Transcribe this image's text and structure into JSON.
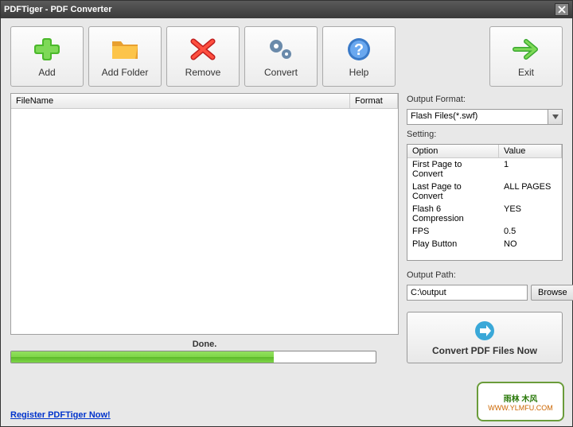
{
  "window": {
    "title": "PDFTiger - PDF Converter"
  },
  "toolbar": {
    "add": "Add",
    "add_folder": "Add Folder",
    "remove": "Remove",
    "convert": "Convert",
    "help": "Help",
    "exit": "Exit"
  },
  "file_table": {
    "col_name": "FileName",
    "col_format": "Format"
  },
  "output": {
    "format_label": "Output Format:",
    "format_value": "Flash Files(*.swf)",
    "setting_label": "Setting:",
    "col_option": "Option",
    "col_value": "Value",
    "rows": [
      {
        "option": "First Page to Convert",
        "value": "1"
      },
      {
        "option": "Last Page to Convert",
        "value": "ALL PAGES"
      },
      {
        "option": "Flash 6 Compression",
        "value": "YES"
      },
      {
        "option": "FPS",
        "value": "0.5"
      },
      {
        "option": "Play Button",
        "value": "NO"
      }
    ],
    "path_label": "Output Path:",
    "path_value": "C:\\output",
    "browse": "Browse"
  },
  "convert_now": "Convert PDF Files Now",
  "status": "Done.",
  "register_link": "Register PDFTiger Now!",
  "watermark": {
    "line1": "雨林 木风",
    "line2": "WWW.YLMFU.COM"
  }
}
